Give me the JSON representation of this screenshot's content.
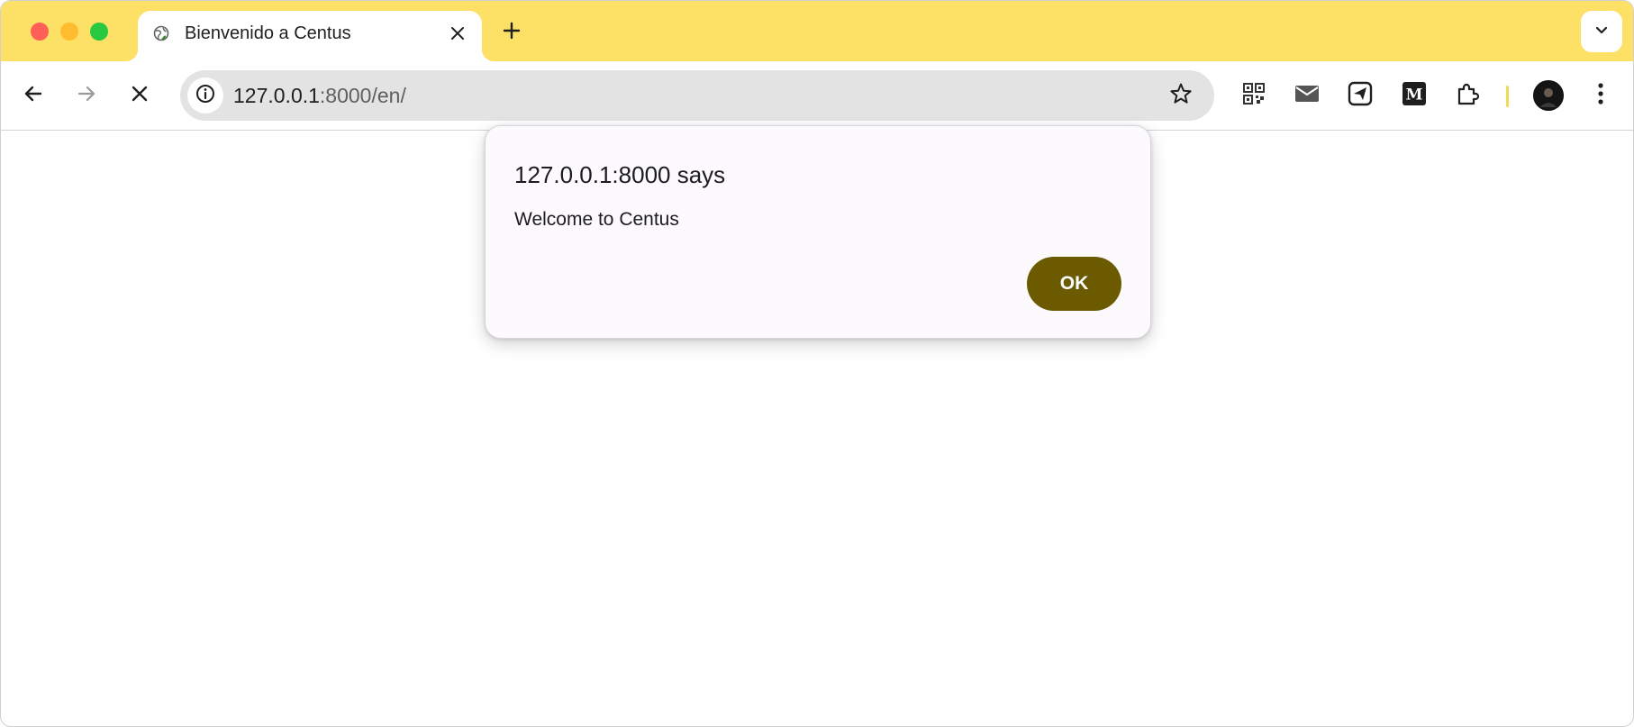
{
  "window": {
    "tab": {
      "title": "Bienvenido a Centus",
      "favicon": "globe-icon",
      "close_icon": "close-icon"
    },
    "new_tab_icon": "plus-icon",
    "tab_search_icon": "chevron-down-icon"
  },
  "toolbar": {
    "back_icon": "arrow-left-icon",
    "forward_icon": "arrow-right-icon",
    "stop_icon": "close-icon",
    "omnibox": {
      "site_info_icon": "info-icon",
      "url_host": "127.0.0.1",
      "url_rest": ":8000/en/",
      "bookmark_icon": "star-icon"
    },
    "extensions": [
      "qr-code-icon",
      "mail-icon",
      "send-icon",
      "medium-icon",
      "puzzle-icon"
    ],
    "menu_icon": "vertical-dots-icon"
  },
  "dialog": {
    "title": "127.0.0.1:8000 says",
    "message": "Welcome to Centus",
    "ok_label": "OK"
  },
  "colors": {
    "tabstrip": "#fde166",
    "omnibox": "#e3e3e3",
    "ok_button": "#6b5a00",
    "dialog_bg": "#fdfafe"
  }
}
